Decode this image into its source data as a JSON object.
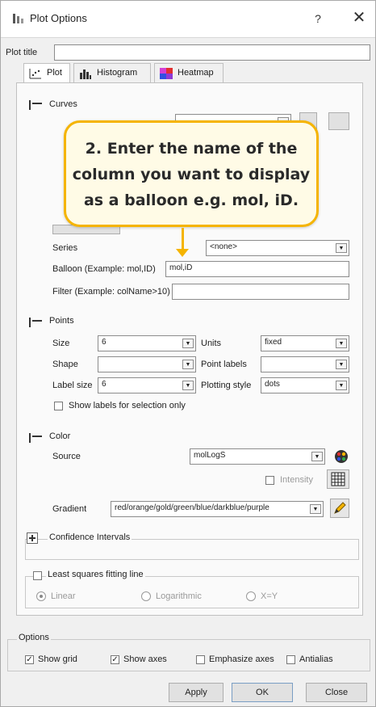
{
  "window": {
    "title": "Plot Options",
    "help_label": "?",
    "close_label": "✕"
  },
  "plot_title": {
    "label": "Plot title",
    "value": ""
  },
  "tabs": [
    {
      "label": "Plot",
      "icon": "scatter-plot-icon",
      "active": true
    },
    {
      "label": "Histogram",
      "icon": "histogram-icon",
      "active": false
    },
    {
      "label": "Heatmap",
      "icon": "heatmap-icon",
      "active": false
    }
  ],
  "curves": {
    "header": "Curves",
    "series_label": "Series",
    "series_value": "<none>",
    "balloon_label": "Balloon (Example: mol,ID)",
    "balloon_value": "mol,iD",
    "filter_label": "Filter (Example: colName>10)",
    "filter_value": ""
  },
  "callout": {
    "line1": "2. Enter the name of the",
    "line2": "column you want to display",
    "line3": "as a balloon e.g. mol, iD.",
    "color": "#f5b400"
  },
  "points": {
    "header": "Points",
    "size_label": "Size",
    "size_value": "6",
    "units_label": "Units",
    "units_value": "fixed",
    "shape_label": "Shape",
    "shape_value": "",
    "point_labels_label": "Point labels",
    "point_labels_value": "",
    "label_size_label": "Label size",
    "label_size_value": "6",
    "plotting_style_label": "Plotting style",
    "plotting_style_value": "dots",
    "show_labels_label": "Show labels for selection only"
  },
  "color": {
    "header": "Color",
    "source_label": "Source",
    "source_value": "molLogS",
    "intensity_label": "Intensity",
    "gradient_label": "Gradient",
    "gradient_value": "red/orange/gold/green/blue/darkblue/purple"
  },
  "confidence": {
    "header": "Confidence Intervals"
  },
  "least_squares": {
    "header": "Least squares fitting line",
    "linear": "Linear",
    "logarithmic": "Logarithmic",
    "xy": "X=Y"
  },
  "options": {
    "header": "Options",
    "show_grid": "Show grid",
    "show_axes": "Show axes",
    "emphasize_axes": "Emphasize axes",
    "antialias": "Antialias"
  },
  "buttons": {
    "apply": "Apply",
    "ok": "OK",
    "close": "Close"
  }
}
